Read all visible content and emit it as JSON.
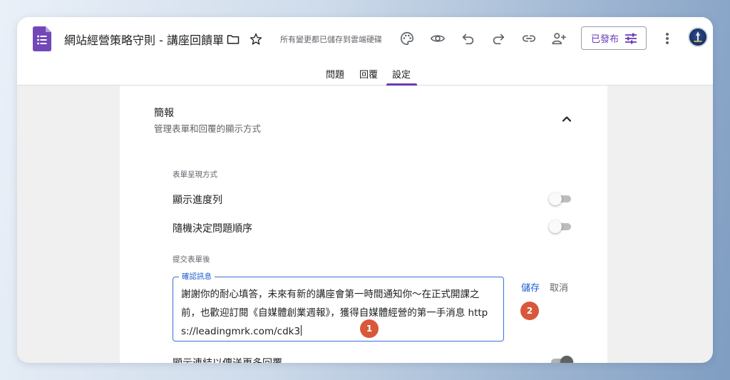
{
  "header": {
    "title": "網站經營策略守則 - 講座回饋單",
    "saved_status": "所有變更都已儲存到雲端硬碟",
    "publish_label": "已發布",
    "icons": [
      "forms-logo-icon",
      "folder-icon",
      "star-icon",
      "palette-icon",
      "eye-icon",
      "undo-icon",
      "redo-icon",
      "link-icon",
      "add-person-icon",
      "tune-icon",
      "more-vert-icon"
    ]
  },
  "tabs": [
    {
      "label": "問題",
      "active": false
    },
    {
      "label": "回覆",
      "active": false
    },
    {
      "label": "設定",
      "active": true
    }
  ],
  "presentation": {
    "title": "簡報",
    "subtitle": "管理表單和回覆的顯示方式",
    "form_display_label": "表單呈現方式",
    "show_progress_label": "顯示進度列",
    "show_progress_on": false,
    "shuffle_label": "隨機決定問題順序",
    "shuffle_on": false,
    "after_submit_label": "提交表單後",
    "confirmation_legend": "確認訊息",
    "confirmation_text": "謝謝你的耐心填答，未來有新的講座會第一時間通知你～在正式開課之前，也歡迎訂閱《自媒體創業週報》，獲得自媒體經營的第一手消息 https://leadingmrk.com/cdk3",
    "save_label": "儲存",
    "cancel_label": "取消",
    "submit_link_label": "顯示連結以傳送更多回覆",
    "submit_link_on": true
  },
  "markers": [
    "1",
    "2"
  ],
  "colors": {
    "accent": "#673ab7",
    "link": "#1a5ad0",
    "focus": "#3b6fd8",
    "marker": "#d9573b"
  }
}
